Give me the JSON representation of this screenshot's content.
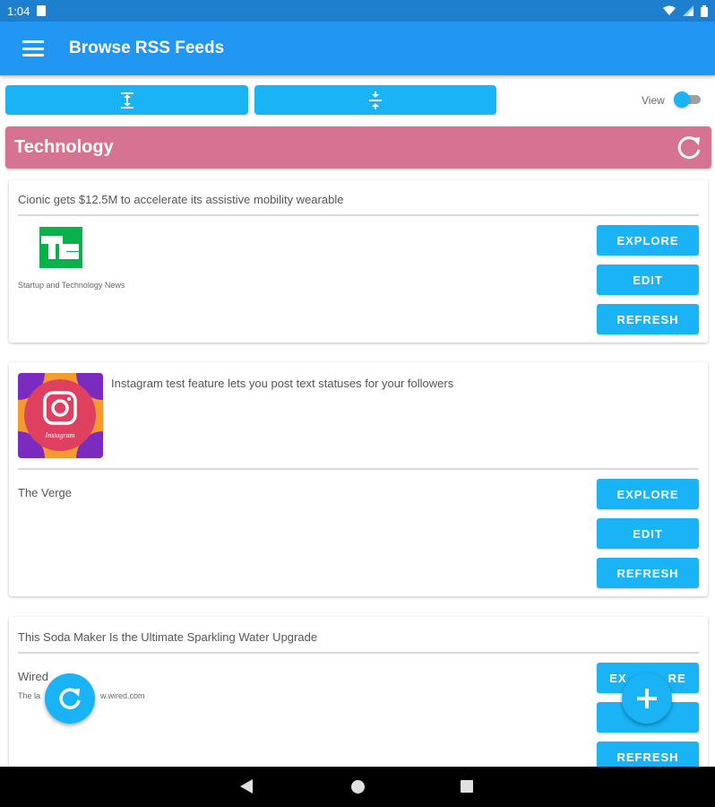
{
  "status_bar": {
    "time": "1:04"
  },
  "app_bar": {
    "title": "Browse RSS Feeds"
  },
  "toolbar": {
    "view_label": "View",
    "view_toggle_on": true
  },
  "category": {
    "title": "Technology",
    "color": "#d67392"
  },
  "feeds": [
    {
      "headline": "Cionic gets $12.5M to accelerate its assistive mobility wearable",
      "source_logo_text": "TC",
      "description": "Startup and Technology News",
      "buttons": {
        "explore": "EXPLORE",
        "edit": "EDIT",
        "refresh": "REFRESH"
      }
    },
    {
      "headline": "Instagram test feature lets you post text statuses for your followers",
      "thumbnail_text": "Instagram",
      "source": "The Verge",
      "buttons": {
        "explore": "EXPLORE",
        "edit": "EDIT",
        "refresh": "REFRESH"
      }
    },
    {
      "headline": "This Soda Maker Is the Ultimate Sparkling Water Upgrade",
      "source": "Wired",
      "description_left": "The la",
      "description_right": "w.wired.com",
      "buttons": {
        "explore_left": "EX",
        "explore_right": "RE",
        "refresh": "REFRESH"
      }
    }
  ],
  "colors": {
    "accent": "#1ab3f5",
    "app_bar": "#2196f3",
    "status_bar": "#1f7fcf"
  },
  "icons": [
    "menu-icon",
    "expand-all-icon",
    "collapse-all-icon",
    "refresh-icon",
    "add-icon"
  ]
}
